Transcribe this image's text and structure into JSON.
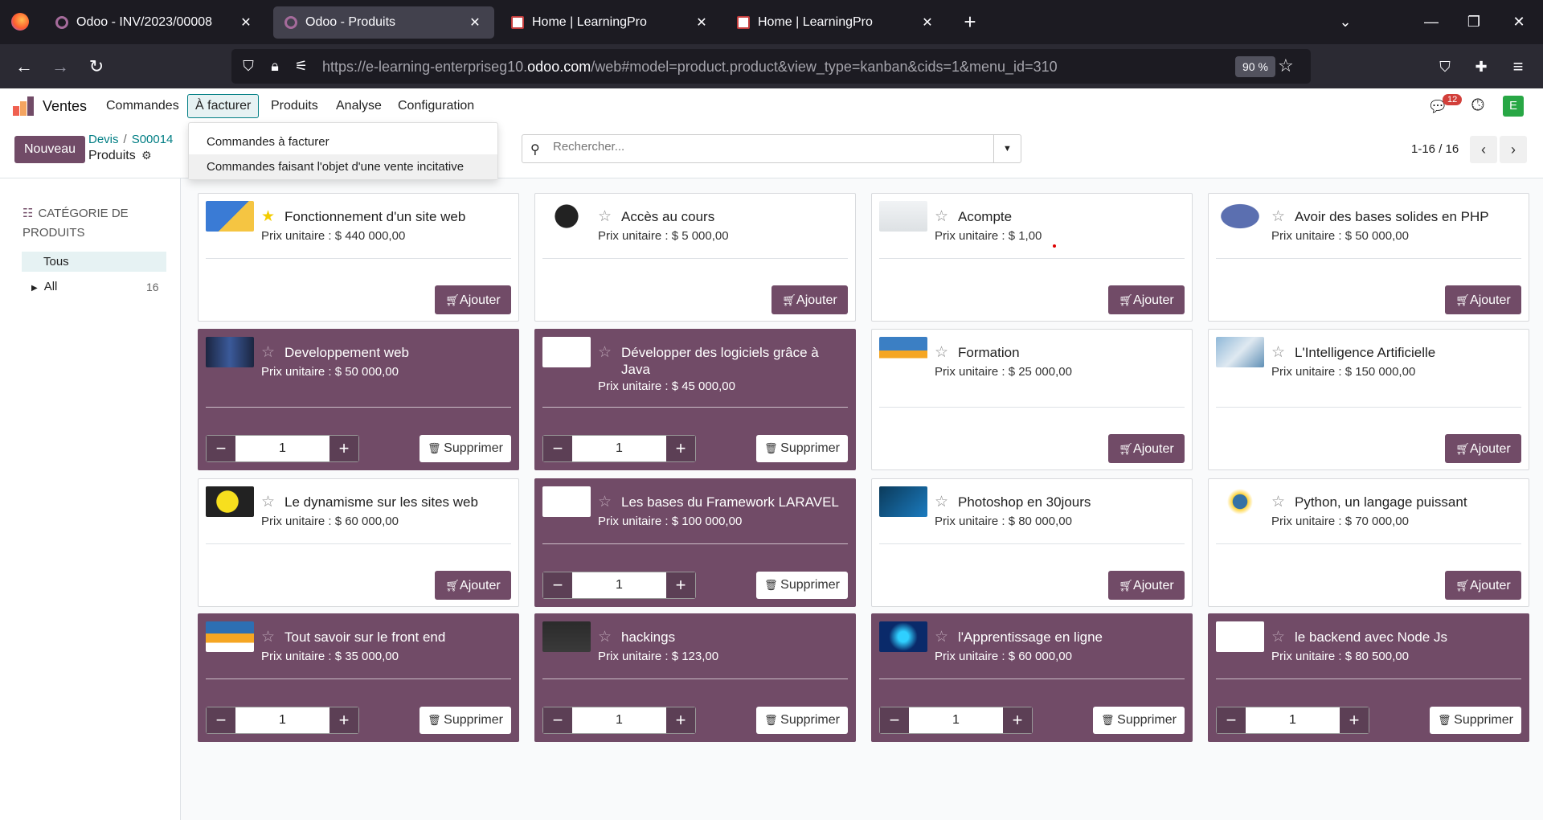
{
  "browser": {
    "tabs": [
      {
        "title": "Odoo - INV/2023/00008",
        "close": "✕",
        "favicon": "odoo-icon"
      },
      {
        "title": "Odoo - Produits",
        "close": "✕",
        "favicon": "odoo-icon",
        "active": true
      },
      {
        "title": "Home | LearningPro",
        "close": "✕",
        "favicon": "learningpro-icon"
      },
      {
        "title": "Home | LearningPro",
        "close": "✕",
        "favicon": "learningpro-icon"
      }
    ],
    "new_tab": "+",
    "url_prefix": "https://e-learning-enterpriseg10.",
    "url_domain": "odoo.com",
    "url_path": "/web#model=product.product&view_type=kanban&cids=1&menu_id=310",
    "zoom": "90 %"
  },
  "app": {
    "name": "Ventes",
    "menu": [
      "Commandes",
      "À facturer",
      "Produits",
      "Analyse",
      "Configuration"
    ],
    "active_menu": "À facturer",
    "message_count": "12",
    "avatar": "E",
    "accent": "#714b67"
  },
  "dropdown": {
    "items": [
      "Commandes à facturer",
      "Commandes faisant l'objet d'une vente incitative"
    ]
  },
  "control": {
    "new_label": "Nouveau",
    "breadcrumb": [
      "Devis",
      "S00014"
    ],
    "current": "Produits",
    "search_placeholder": "Rechercher...",
    "pager": "1-16 / 16"
  },
  "sidebar": {
    "title": "CATÉGORIE DE PRODUITS",
    "tous": "Tous",
    "all": "All",
    "all_count": "16"
  },
  "products": [
    {
      "name": "Fonctionnement d'un site web",
      "price": "Prix unitaire : $ 440 000,00",
      "favorite": true,
      "in_order": false,
      "add": "Ajouter"
    },
    {
      "name": "Accès au cours",
      "price": "Prix unitaire : $ 5 000,00",
      "favorite": false,
      "in_order": false,
      "add": "Ajouter"
    },
    {
      "name": "Acompte",
      "price": "Prix unitaire : $ 1,00",
      "favorite": false,
      "in_order": false,
      "add": "Ajouter"
    },
    {
      "name": "Avoir des bases solides en PHP",
      "price": "Prix unitaire : $ 50 000,00",
      "favorite": false,
      "in_order": false,
      "add": "Ajouter"
    },
    {
      "name": "Developpement web",
      "price": "Prix unitaire : $ 50 000,00",
      "favorite": false,
      "in_order": true,
      "qty": "1",
      "remove": "Supprimer"
    },
    {
      "name": "Développer des logiciels grâce à Java",
      "price": "Prix unitaire : $ 45 000,00",
      "favorite": false,
      "in_order": true,
      "qty": "1",
      "remove": "Supprimer"
    },
    {
      "name": "Formation",
      "price": "Prix unitaire : $ 25 000,00",
      "favorite": false,
      "in_order": false,
      "add": "Ajouter"
    },
    {
      "name": "L'Intelligence Artificielle",
      "price": "Prix unitaire : $ 150 000,00",
      "favorite": false,
      "in_order": false,
      "add": "Ajouter"
    },
    {
      "name": "Le dynamisme sur les sites web",
      "price": "Prix unitaire : $ 60 000,00",
      "favorite": false,
      "in_order": false,
      "add": "Ajouter"
    },
    {
      "name": "Les bases du Framework LARAVEL",
      "price": "Prix unitaire : $ 100 000,00",
      "favorite": false,
      "in_order": true,
      "qty": "1",
      "remove": "Supprimer"
    },
    {
      "name": "Photoshop en 30jours",
      "price": "Prix unitaire : $ 80 000,00",
      "favorite": false,
      "in_order": false,
      "add": "Ajouter"
    },
    {
      "name": "Python, un langage puissant",
      "price": "Prix unitaire : $ 70 000,00",
      "favorite": false,
      "in_order": false,
      "add": "Ajouter"
    },
    {
      "name": "Tout savoir sur le front end",
      "price": "Prix unitaire : $ 35 000,00",
      "favorite": false,
      "in_order": true,
      "qty": "1",
      "remove": "Supprimer"
    },
    {
      "name": "hackings",
      "price": "Prix unitaire : $ 123,00",
      "favorite": false,
      "in_order": true,
      "qty": "1",
      "remove": "Supprimer"
    },
    {
      "name": "l'Apprentissage en ligne",
      "price": "Prix unitaire : $ 60 000,00",
      "favorite": false,
      "in_order": true,
      "qty": "1",
      "remove": "Supprimer"
    },
    {
      "name": "le backend avec Node Js",
      "price": "Prix unitaire : $ 80 500,00",
      "favorite": false,
      "in_order": true,
      "qty": "1",
      "remove": "Supprimer"
    }
  ]
}
